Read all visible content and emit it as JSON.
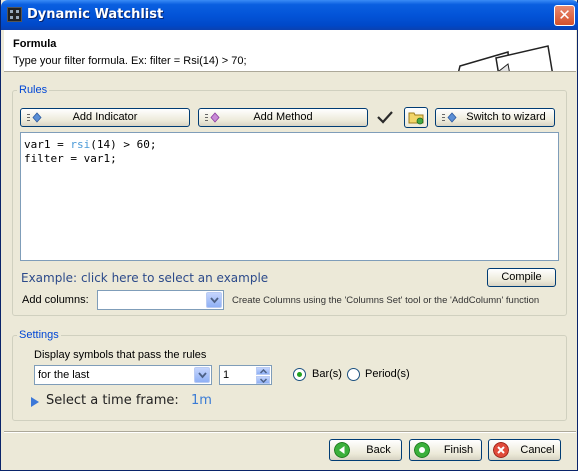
{
  "window": {
    "title": "Dynamic Watchlist",
    "close_glyph": "✕"
  },
  "header": {
    "title": "Formula",
    "description": "Type your filter formula. Ex: filter = Rsi(14) > 70;"
  },
  "rules": {
    "legend": "Rules",
    "add_indicator_label": "Add Indicator",
    "add_method_label": "Add Method",
    "switch_wizard_label": "Switch to wizard",
    "formula_line1_pre": "var1 = ",
    "formula_line1_fn": "rsi",
    "formula_line1_post": "(14) > 60;",
    "formula_line2": "filter = var1;",
    "example_label": "Example:",
    "example_link": "click here to select an example",
    "compile_label": "Compile",
    "add_columns_label": "Add columns:",
    "add_columns_value": "",
    "add_columns_hint": "Create Columns using the 'Columns Set' tool or the 'AddColumn' function"
  },
  "settings": {
    "legend": "Settings",
    "display_label": "Display symbols that pass the rules",
    "period_select_value": "for the last",
    "count_value": "1",
    "radio_bars_label": "Bar(s)",
    "radio_periods_label": "Period(s)",
    "bars_selected": true,
    "time_frame_label": "Select a time frame:",
    "time_frame_value": "1m"
  },
  "footer": {
    "back_label": "Back",
    "finish_label": "Finish",
    "cancel_label": "Cancel"
  },
  "colors": {
    "accent": "#0046d5",
    "link": "#2c4a8a",
    "formula_function": "#4a9ad8",
    "time_frame_value": "#3a7bd5"
  }
}
